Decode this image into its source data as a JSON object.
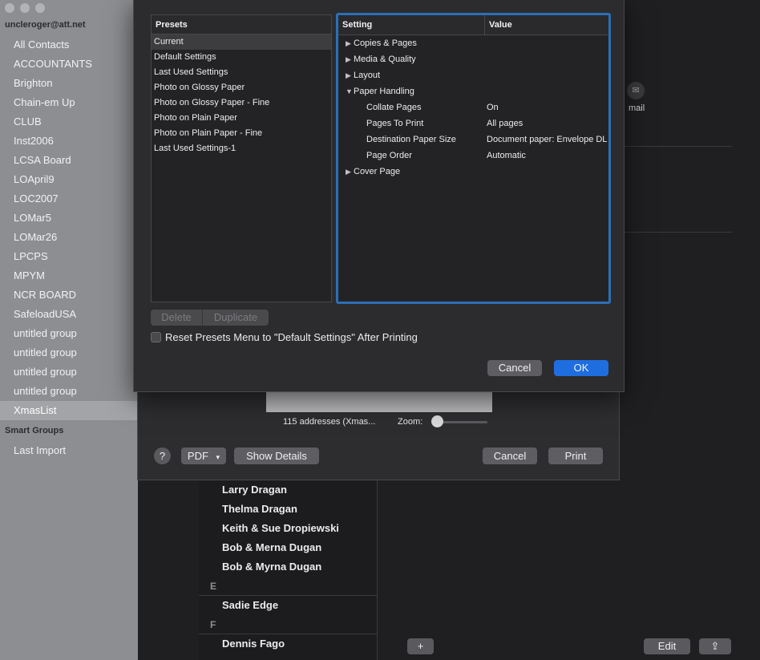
{
  "account": "uncleroger@att.net",
  "groups": [
    "All Contacts",
    "ACCOUNTANTS",
    "Brighton",
    "Chain-em Up",
    "CLUB",
    "Inst2006",
    "LCSA Board",
    "LOApril9",
    "LOC2007",
    "LOMar5",
    "LOMar26",
    "LPCPS",
    "MPYM",
    "NCR BOARD",
    "SafeloadUSA",
    "untitled group",
    "untitled group",
    "untitled group",
    "untitled group",
    "XmasList"
  ],
  "selected_group": "XmasList",
  "smart_groups": {
    "header": "Smart Groups",
    "items": [
      "Last Import"
    ]
  },
  "contacts": {
    "partial": "...",
    "items_d": [
      "Larry Dragan",
      "Thelma Dragan",
      "Keith & Sue Dropiewski",
      "Bob & Merna Dugan",
      "Bob & Myrna Dugan"
    ],
    "section_e": "E",
    "items_e": [
      "Sadie Edge"
    ],
    "section_f": "F",
    "items_f": [
      "Dennis Fago"
    ]
  },
  "detail": {
    "mail_label": "mail",
    "edit_label": "Edit",
    "add_label": "+",
    "share_label": "⇪"
  },
  "print_panel": {
    "addresses": "115 addresses (Xmas...",
    "zoom_label": "Zoom:",
    "help": "?",
    "pdf": "PDF",
    "show_details": "Show Details",
    "cancel": "Cancel",
    "print": "Print"
  },
  "presets_sheet": {
    "presets_header": "Presets",
    "presets": [
      "Current",
      "Default Settings",
      "Last Used Settings",
      "Photo on Glossy Paper",
      "Photo on Glossy Paper - Fine",
      "Photo on Plain Paper",
      "Photo on Plain Paper - Fine",
      "Last Used Settings-1"
    ],
    "setting_header": "Setting",
    "value_header": "Value",
    "settings": [
      {
        "name": "Copies & Pages",
        "value": "",
        "expander": "▶"
      },
      {
        "name": "Media & Quality",
        "value": "",
        "expander": "▶"
      },
      {
        "name": "Layout",
        "value": "",
        "expander": "▶"
      },
      {
        "name": "Paper Handling",
        "value": "",
        "expander": "▼"
      },
      {
        "name": "Collate Pages",
        "value": "On",
        "child": true
      },
      {
        "name": "Pages To Print",
        "value": "All pages",
        "child": true
      },
      {
        "name": "Destination Paper Size",
        "value": "Document paper: Envelope DL",
        "child": true
      },
      {
        "name": "Page Order",
        "value": "Automatic",
        "child": true
      },
      {
        "name": "Cover Page",
        "value": "",
        "expander": "▶"
      }
    ],
    "delete_label": "Delete",
    "duplicate_label": "Duplicate",
    "reset_label": "Reset Presets Menu to \"Default Settings\" After Printing",
    "cancel_label": "Cancel",
    "ok_label": "OK"
  },
  "colors": {
    "accent": "#1f6ee0",
    "focus_ring": "#2c6fb7"
  }
}
